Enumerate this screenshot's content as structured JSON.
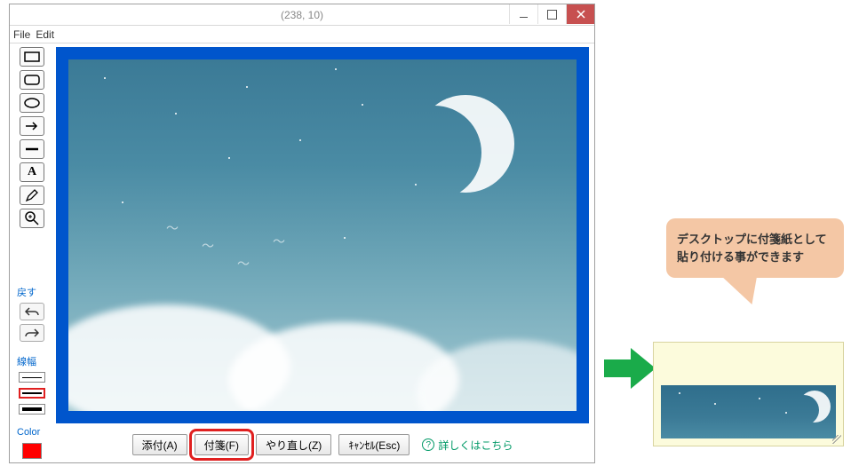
{
  "window": {
    "title": "(238, 10)"
  },
  "menubar": {
    "file": "File",
    "edit": "Edit"
  },
  "labels": {
    "undo_section": "戻す",
    "linewidth": "線幅",
    "color": "Color"
  },
  "icons": {
    "rect": "rect-icon",
    "rrect": "rounded-rect-icon",
    "ellipse": "ellipse-icon",
    "arrow": "arrow-icon",
    "line": "line-icon",
    "text": "text-icon",
    "pen": "pen-icon",
    "zoom": "zoom-icon",
    "undo": "undo-icon",
    "redo": "redo-icon"
  },
  "buttons": {
    "attach": "添付(A)",
    "sticky": "付箋(F)",
    "redo": "やり直し(Z)",
    "cancel": "ｷｬﾝｾﾙ(Esc)"
  },
  "help_link": "詳しくはこちら",
  "callout": {
    "line1": "デスクトップに付箋紙として",
    "line2": "貼り付ける事ができます"
  },
  "colors": {
    "accent_blue": "#0055cc",
    "highlight_red": "#e02020",
    "callout_bg": "#f4c7a5",
    "sticky_bg": "#fcfbdc",
    "arrow_green": "#1aab4a",
    "swatch": "#ff0000"
  }
}
